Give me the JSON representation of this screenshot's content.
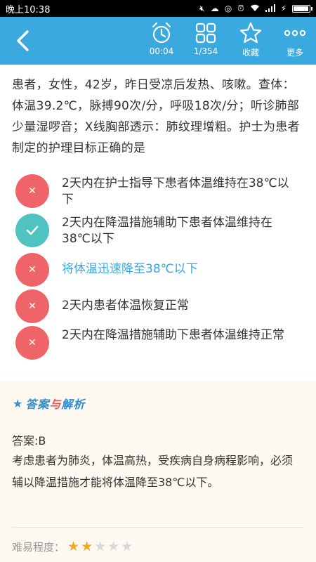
{
  "status_bar": {
    "time": "晚上10:38",
    "icons": [
      "mute-icon",
      "cloud-icon",
      "headset-icon",
      "alarm-icon",
      "wifi-icon",
      "signal-icon",
      "charging-icon"
    ],
    "battery_level": 0.95
  },
  "toolbar": {
    "back_icon": "chevron-left-icon",
    "timer_label": "00:04",
    "progress_label": "1/354",
    "favorite_label": "收藏",
    "more_label": "更多",
    "color": "#39a9e0"
  },
  "question": {
    "text": "患者，女性，42岁，昨日受凉后发热、咳嗽。查体：体温39.2℃，脉搏90次/分，呼吸18次/分；听诊肺部少量湿啰音；X线胸部透示：肺纹理增粗。护士为患者制定的护理目标正确的是"
  },
  "options": [
    {
      "text": "2天内在护士指导下患者体温维持在38℃以下",
      "state": "wrong",
      "icon": "close-icon"
    },
    {
      "text": "2天内在降温措施辅助下患者体温维持在38℃以下",
      "state": "correct",
      "icon": "check-icon"
    },
    {
      "text": "将体温迅速降至38℃以下",
      "state": "selected-wrong",
      "icon": "close-icon"
    },
    {
      "text": "2天内患者体温恢复正常",
      "state": "wrong",
      "icon": "close-icon"
    },
    {
      "text": "2天内在降温措施辅助下患者体温维持正常",
      "state": "wrong",
      "icon": "close-icon"
    }
  ],
  "answer": {
    "header_star_icon": "star-icon",
    "title_part1": "答案",
    "title_part2": "与",
    "title_part3": "解析",
    "answer_line": "答案:B",
    "explanation": "考虑患者为肺炎，体温高热，受疾病自身病程影响，必须辅以降温措施才能将体温降至38℃以下。",
    "difficulty_label": "难易程度：",
    "difficulty_rating": 2,
    "difficulty_max": 5
  }
}
